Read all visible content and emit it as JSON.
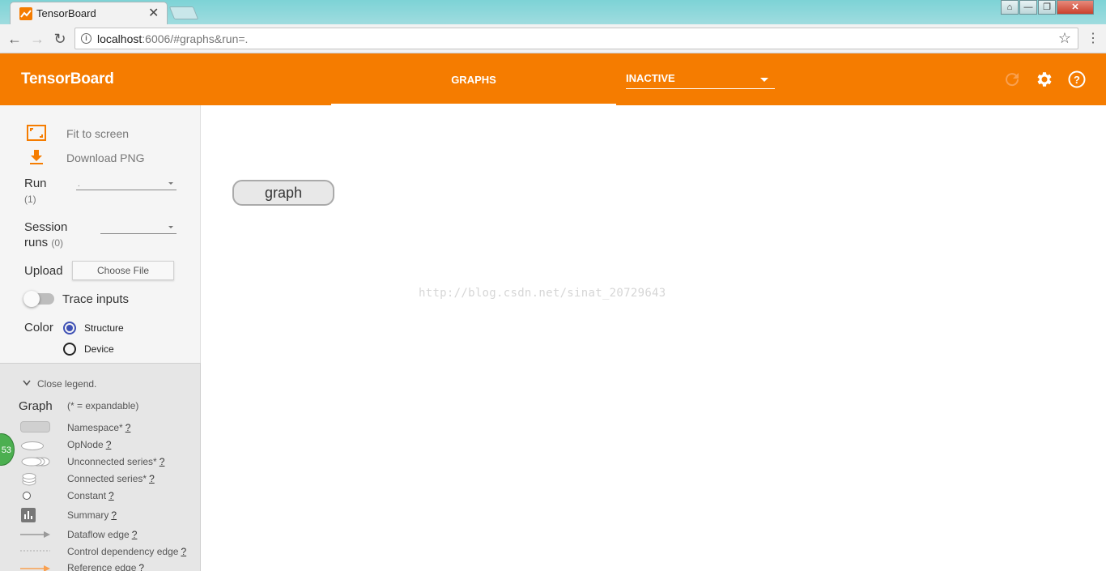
{
  "browser": {
    "tab_title": "TensorBoard",
    "tab_close": "✕",
    "url_host": "localhost",
    "url_rest": ":6006/#graphs&run=.",
    "window_buttons": [
      "⌂",
      "—",
      "❐",
      "✕"
    ]
  },
  "header": {
    "title": "TensorBoard",
    "active_tab": "GRAPHS",
    "dropdown_value": "INACTIVE"
  },
  "sidebar": {
    "fit_to_screen": "Fit to screen",
    "download_png": "Download PNG",
    "run_label": "Run",
    "run_count": "(1)",
    "run_value": ".",
    "session_label_1": "Session",
    "session_label_2": "runs",
    "session_count": "(0)",
    "upload_label": "Upload",
    "choose_file": "Choose File",
    "trace_inputs": "Trace inputs",
    "color_label": "Color",
    "color_options": [
      "Structure",
      "Device"
    ],
    "color_selected": "Structure"
  },
  "legend": {
    "toggle": "Close legend.",
    "title": "Graph",
    "subtitle": "(* = expandable)",
    "help_mark": "?",
    "items": [
      "Namespace*",
      "OpNode",
      "Unconnected series*",
      "Connected series*",
      "Constant",
      "Summary",
      "Dataflow edge",
      "Control dependency edge",
      "Reference edge"
    ]
  },
  "badge": {
    "value": "53"
  },
  "canvas": {
    "node_label": "graph",
    "watermark": "http://blog.csdn.net/sinat_20729643"
  },
  "colors": {
    "brand_orange": "#f57c00",
    "radio_accent": "#3f51b5"
  }
}
